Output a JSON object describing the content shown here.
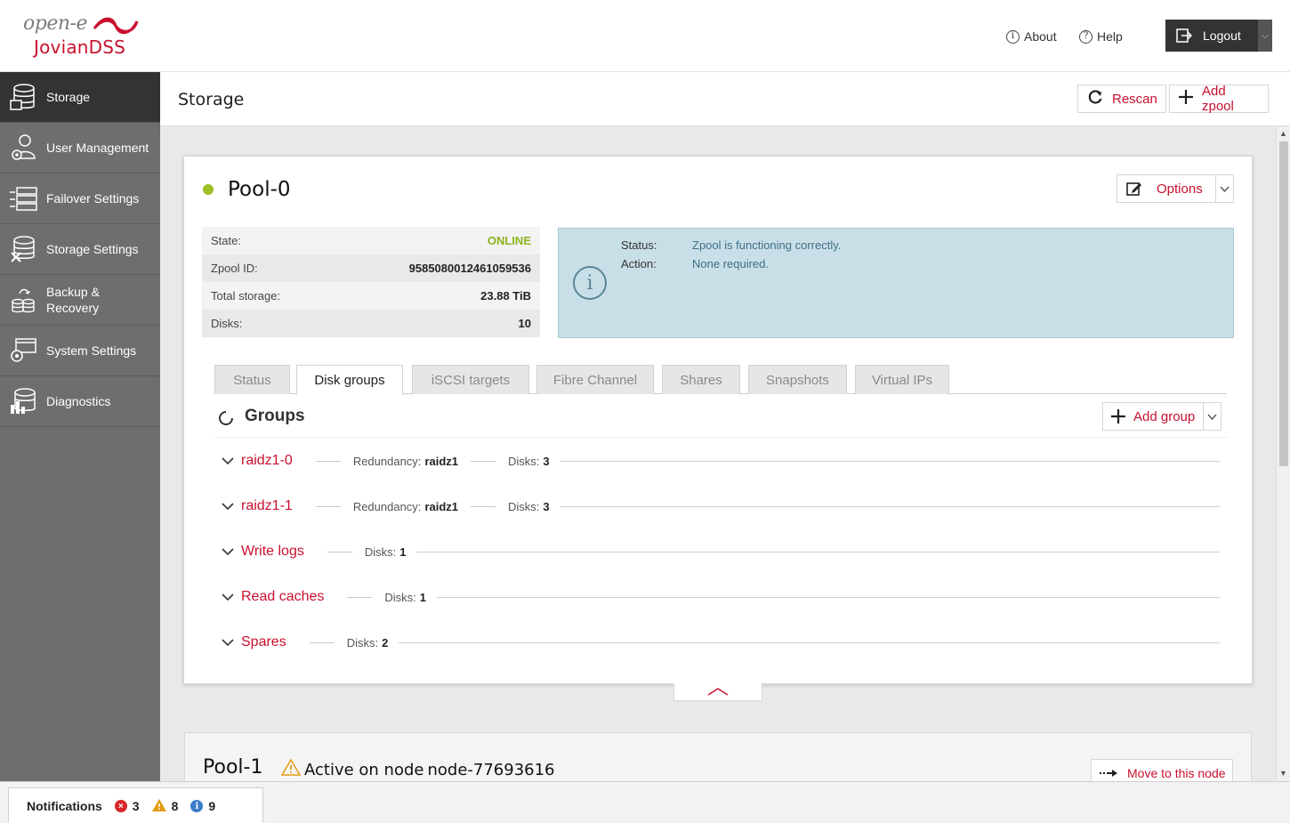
{
  "brand": {
    "top": "open-e",
    "bottom": "JovianDSS"
  },
  "header": {
    "about_label": "About",
    "help_label": "Help",
    "logout_label": "Logout"
  },
  "sidebar": {
    "items": [
      {
        "label": "Storage",
        "icon": "storage-icon",
        "active": true
      },
      {
        "label": "User Management",
        "icon": "user-gear-icon"
      },
      {
        "label": "Failover Settings",
        "icon": "failover-icon"
      },
      {
        "label": "Storage Settings",
        "icon": "storage-settings-icon"
      },
      {
        "label": "Backup &",
        "label2": "Recovery",
        "icon": "backup-icon"
      },
      {
        "label": "System Settings",
        "icon": "system-settings-icon"
      },
      {
        "label": "Diagnostics",
        "icon": "diagnostics-icon"
      }
    ]
  },
  "titlebar": {
    "title": "Storage",
    "rescan_label": "Rescan",
    "add_zpool_label": "Add zpool"
  },
  "pool0": {
    "name": "Pool-0",
    "options_label": "Options",
    "props": [
      {
        "label": "State:",
        "value": "ONLINE"
      },
      {
        "label": "Zpool ID:",
        "value": "9585080012461059536"
      },
      {
        "label": "Total storage:",
        "value": "23.88 TiB"
      },
      {
        "label": "Disks:",
        "value": "10"
      }
    ],
    "status": {
      "status_label": "Status:",
      "status_value": "Zpool is functioning correctly.",
      "action_label": "Action:",
      "action_value": "None required."
    },
    "tabs": [
      "Status",
      "Disk groups",
      "iSCSI targets",
      "Fibre Channel",
      "Shares",
      "Snapshots",
      "Virtual IPs"
    ],
    "active_tab": "Disk groups",
    "groups_title": "Groups",
    "add_group_label": "Add group",
    "groups": [
      {
        "name": "raidz1-0",
        "redundancy_label": "Redundancy:",
        "redundancy": "raidz1",
        "disks_label": "Disks:",
        "disks": "3"
      },
      {
        "name": "raidz1-1",
        "redundancy_label": "Redundancy:",
        "redundancy": "raidz1",
        "disks_label": "Disks:",
        "disks": "3"
      },
      {
        "name": "Write logs",
        "disks_label": "Disks:",
        "disks": "1"
      },
      {
        "name": "Read caches",
        "disks_label": "Disks:",
        "disks": "1"
      },
      {
        "name": "Spares",
        "disks_label": "Disks:",
        "disks": "2"
      }
    ]
  },
  "pool1": {
    "name": "Pool-1",
    "active_on_label": "Active on node",
    "node": "node-77693616",
    "move_label": "Move to this node"
  },
  "notifications": {
    "label": "Notifications",
    "errors": "3",
    "warnings": "8",
    "info": "9"
  },
  "colors": {
    "accent": "#c8102e",
    "online": "#8fb21d",
    "sidebar": "#6e6e6e",
    "sidebar_active": "#333333"
  }
}
